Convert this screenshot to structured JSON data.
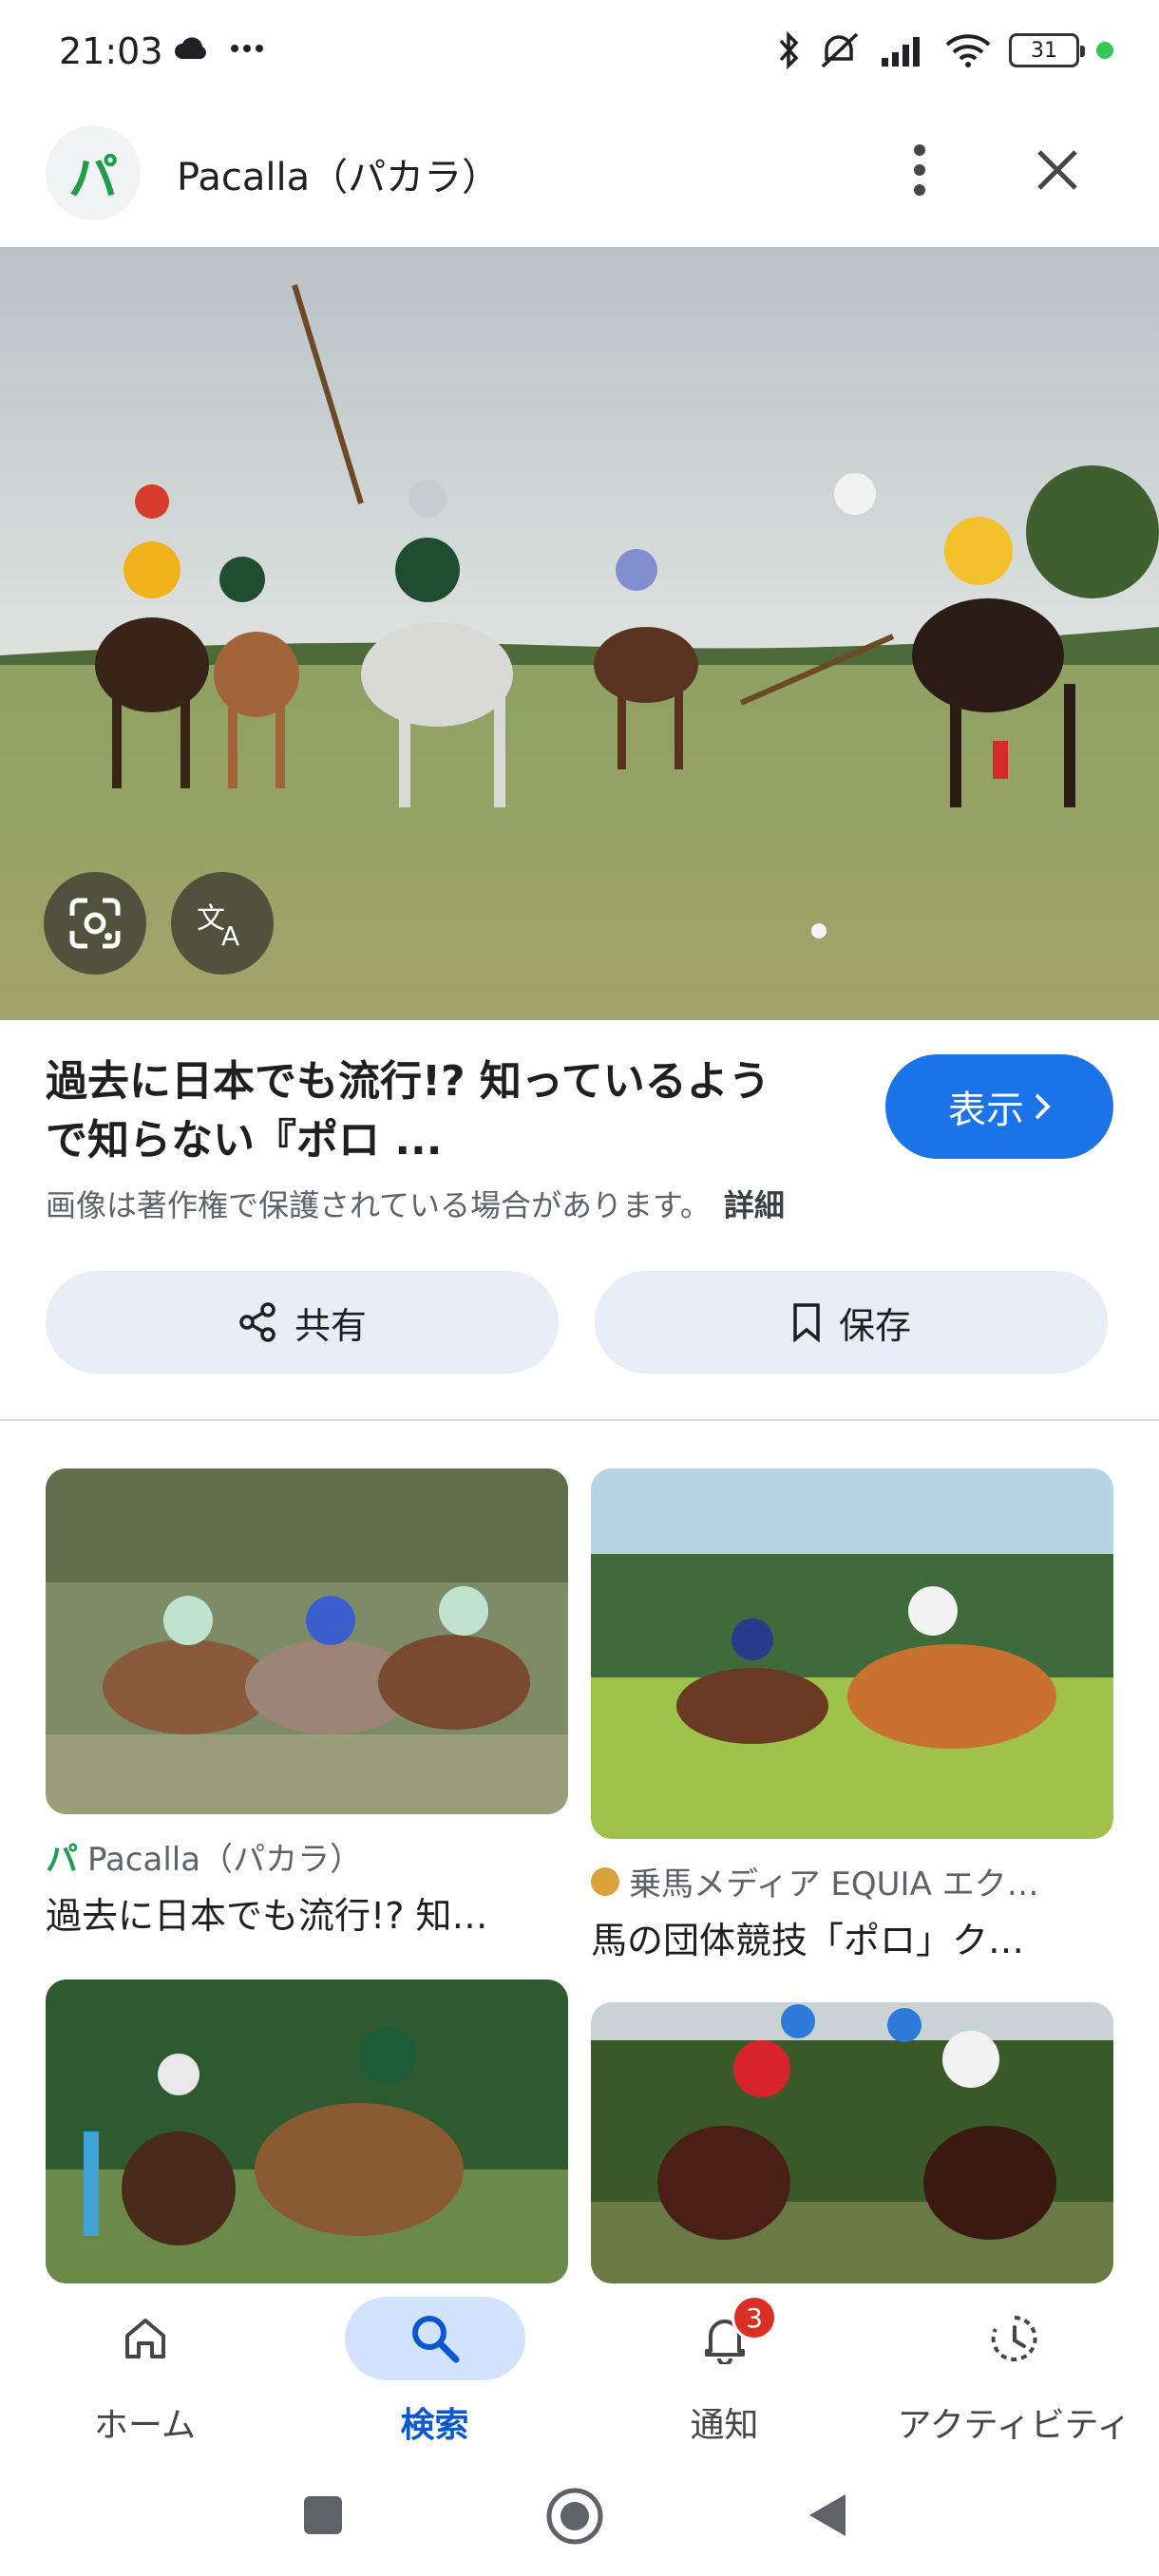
{
  "status": {
    "time": "21:03",
    "battery": "31"
  },
  "header": {
    "logo_glyph": "パ",
    "title": "Pacalla（パカラ）"
  },
  "result": {
    "title_line1": "過去に日本でも流行!? 知っているよう",
    "title_line2": "で知らない『ポロ ...",
    "visit_label": "表示",
    "copyright_text": "画像は著作権で保護されている場合があります。",
    "details_label": "詳細",
    "share_label": "共有",
    "save_label": "保存"
  },
  "related": [
    {
      "source": "Pacalla（パカラ）",
      "caption": "過去に日本でも流行!? 知…"
    },
    {
      "source": "乗馬メディア EQUIA エク…",
      "caption": "馬の団体競技「ポロ」ク…"
    }
  ],
  "nav": {
    "items": [
      {
        "label": "ホーム",
        "icon": "home-icon"
      },
      {
        "label": "検索",
        "icon": "search-icon"
      },
      {
        "label": "通知",
        "icon": "bell-icon"
      },
      {
        "label": "アクティビティ",
        "icon": "activity-icon"
      }
    ],
    "notification_count": "3",
    "active_index": 1
  },
  "colors": {
    "accent": "#1a73e8",
    "active_nav_bg": "#d3e3fd",
    "badge": "#d93025"
  }
}
